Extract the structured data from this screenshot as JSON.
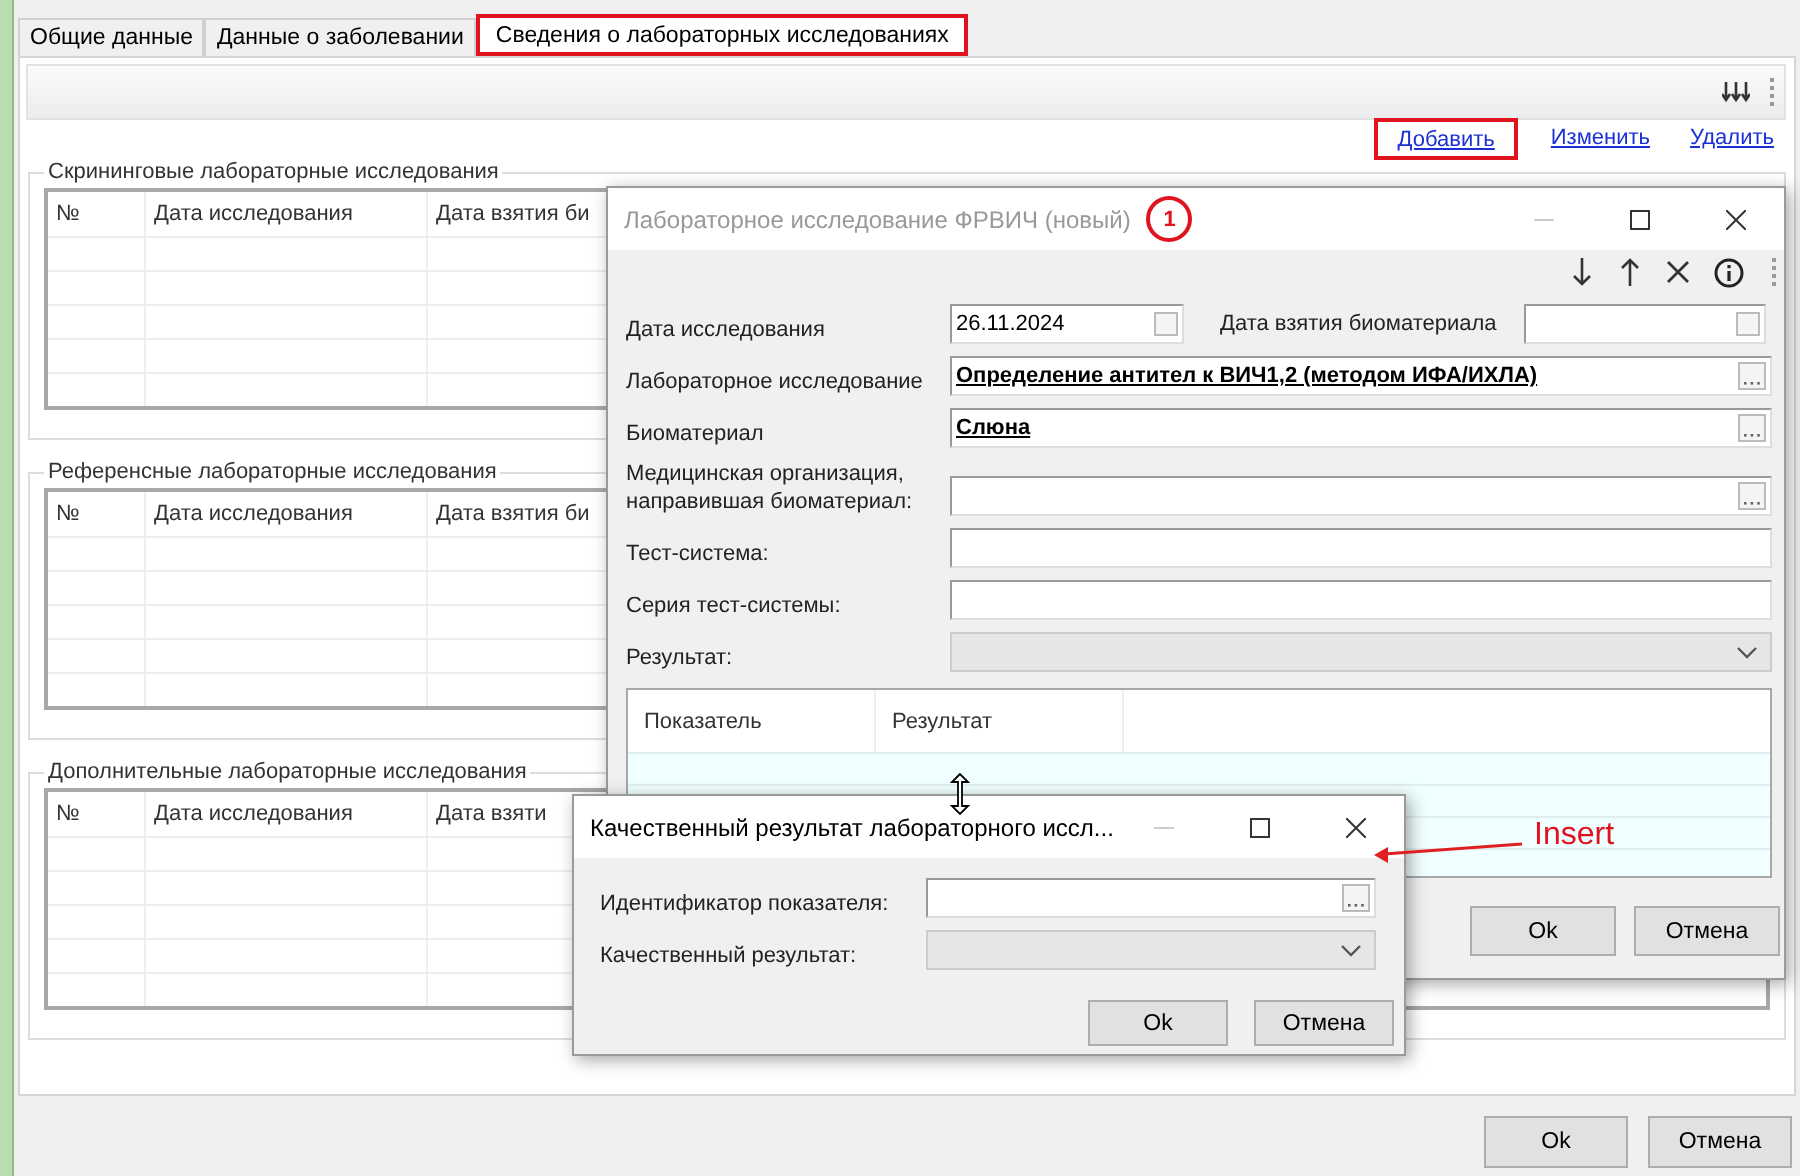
{
  "tabs": [
    {
      "label": "Общие данные",
      "selected": false,
      "highlighted": false
    },
    {
      "label": "Данные о заболевании",
      "selected": false,
      "highlighted": false
    },
    {
      "label": "Сведения о лабораторных исследованиях",
      "selected": true,
      "highlighted": true
    }
  ],
  "actions": [
    {
      "label": "Добавить",
      "highlighted": true
    },
    {
      "label": "Изменить",
      "highlighted": false
    },
    {
      "label": "Удалить",
      "highlighted": false
    }
  ],
  "groups": [
    {
      "title": "Скрининговые лабораторные исследования",
      "columns": [
        "№",
        "Дата исследования",
        "Дата взятия би"
      ]
    },
    {
      "title": "Референсные лабораторные исследования",
      "columns": [
        "№",
        "Дата исследования",
        "Дата взятия би"
      ]
    },
    {
      "title": "Дополнительные лабораторные исследования",
      "columns": [
        "№",
        "Дата исследования",
        "Дата взяти"
      ]
    }
  ],
  "footer_buttons": [
    "Ok",
    "Отмена"
  ],
  "lab_dialog": {
    "title": "Лабораторное исследование ФРВИЧ (новый)",
    "active": false,
    "marker": "1",
    "fields": [
      {
        "kind": "date",
        "label": "Дата исследования",
        "value": "26.11.2024",
        "side_label": "Дата взятия биоматериала"
      },
      {
        "kind": "lookup",
        "label": "Лабораторное исследование",
        "value": "Определение антител к ВИЧ1,2 (методом ИФА/ИХЛА)"
      },
      {
        "kind": "lookup",
        "label": "Биоматериал",
        "value": "Слюна"
      },
      {
        "kind": "lookup",
        "label": "Медицинская организация, направившая биоматериал:"
      },
      {
        "kind": "text",
        "label": "Тест-система:"
      },
      {
        "kind": "text",
        "label": "Серия тест-системы:"
      },
      {
        "kind": "combo",
        "label": "Результат:",
        "disabled": true
      }
    ],
    "grid": {
      "columns": [
        "Показатель",
        "Результат"
      ]
    },
    "buttons": [
      "Ok",
      "Отмена"
    ]
  },
  "result_dialog": {
    "title": "Качественный результат лабораторного иссл...",
    "active": true,
    "fields": [
      {
        "kind": "lookup",
        "label": "Идентификатор показателя:"
      },
      {
        "kind": "combo",
        "label": "Качественный результат:",
        "disabled": true
      }
    ],
    "buttons": [
      "Ok",
      "Отмена"
    ]
  },
  "annotation": {
    "text": "Insert"
  }
}
